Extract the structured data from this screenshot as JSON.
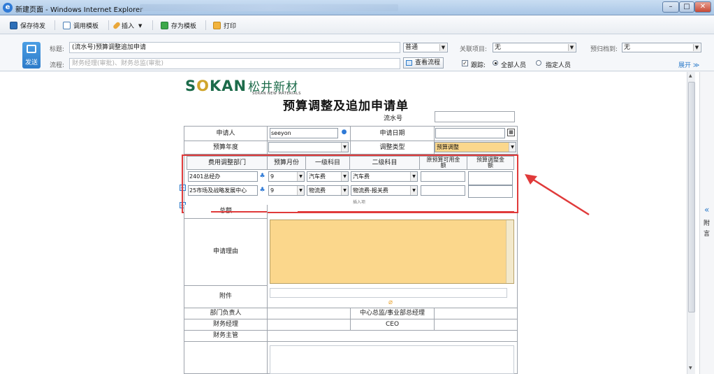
{
  "window": {
    "title": "新建页面 - Windows Internet Explorer",
    "min_label": "–",
    "max_label": "□",
    "close_label": "✕"
  },
  "toolbar": {
    "save_pending": "保存待发",
    "call_template": "调用模板",
    "insert": "插入",
    "save_template": "存为模板",
    "print": "打印"
  },
  "header": {
    "send_label": "发送",
    "title_label": "标题:",
    "title_value": "(流水号)预算调整追加申请",
    "flow_label": "流程:",
    "flow_placeholder": "财务经理(审批)、财务总监(审批)",
    "priority_value": "普通",
    "related_label": "关联项目:",
    "related_value": "无",
    "archive_label": "预归档到:",
    "archive_value": "无",
    "view_flow": "查看流程",
    "track_label": "跟踪:",
    "all_people": "全部人员",
    "specific_people": "指定人员",
    "expand": "展开"
  },
  "form": {
    "logo_text": "S",
    "logo_o": "O",
    "logo_rest": "KAN",
    "logo_cn": "松井新材",
    "logo_sub": "SOKAN NEW MATERIALS",
    "title": "预算调整及追加申请单",
    "serial_label": "流水号",
    "applicant_label": "申请人",
    "applicant_value": "seeyon",
    "apply_date_label": "申请日期",
    "budget_year_label": "预算年度",
    "adjust_type_label": "调整类型",
    "adjust_type_value": "预算调整",
    "col_dept": "费用调整部门",
    "col_month": "预算月份",
    "col_l1": "一级科目",
    "col_l2": "二级科目",
    "col_orig": "原预算可用金额",
    "col_adjust": "预算调整金额",
    "rows": [
      {
        "dept": "2401总经办",
        "month": "9",
        "l1": "汽车费",
        "l2": "汽车费"
      },
      {
        "dept": "25市场及战略发展中心",
        "month": "9",
        "l1": "物流费",
        "l2": "物流费-报关费"
      }
    ],
    "insert_item": "插入项",
    "total_label": "总额",
    "reason_label": "申请理由",
    "attachment_label": "附件",
    "dept_head_label": "部门负责人",
    "center_head_label": "中心总监/事业部总经理",
    "finance_mgr_label": "财务经理",
    "ceo_label": "CEO",
    "finance_chief_label": "财务主管"
  },
  "sidepanel": {
    "chevron": "«",
    "label1": "附",
    "label2": "言"
  },
  "colors": {
    "accent": "#2d7bc9",
    "highlight": "#fbd78c",
    "annotation_red": "#e03a3a"
  }
}
